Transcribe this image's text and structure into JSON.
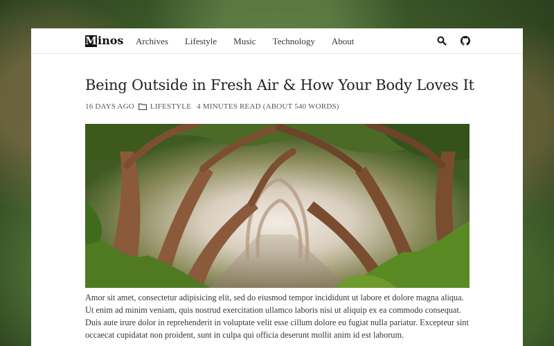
{
  "site": {
    "logo_initial": "M",
    "logo_rest": "inos"
  },
  "nav": {
    "items": [
      {
        "label": "Archives"
      },
      {
        "label": "Lifestyle"
      },
      {
        "label": "Music"
      },
      {
        "label": "Technology"
      },
      {
        "label": "About"
      }
    ],
    "icons": [
      "search-icon",
      "github-icon"
    ]
  },
  "post": {
    "title": "Being Outside in Fresh Air & How Your Body Loves It",
    "date": "16 days ago",
    "category": "Lifestyle",
    "read_time": "4 minutes read (About 540 words)",
    "hero_alt": "Forest tunnel of arching trees",
    "excerpt": "Amor sit amet, consectetur adipisicing elit, sed do eiusmod tempor incididunt ut labore et dolore magna aliqua. Ut enim ad minim veniam, quis nostrud exercitation ullamco laboris nisi ut aliquip ex ea commodo consequat. Duis aute irure dolor in reprehenderit in voluptate velit esse cillum dolore eu fugiat nulla pariatur. Excepteur sint occaecat cupidatat non proident, sunt in culpa qui officia deserunt mollit anim id est laborum."
  },
  "colors": {
    "page_bg": "#ffffff",
    "text": "#363636",
    "title": "#222222"
  }
}
